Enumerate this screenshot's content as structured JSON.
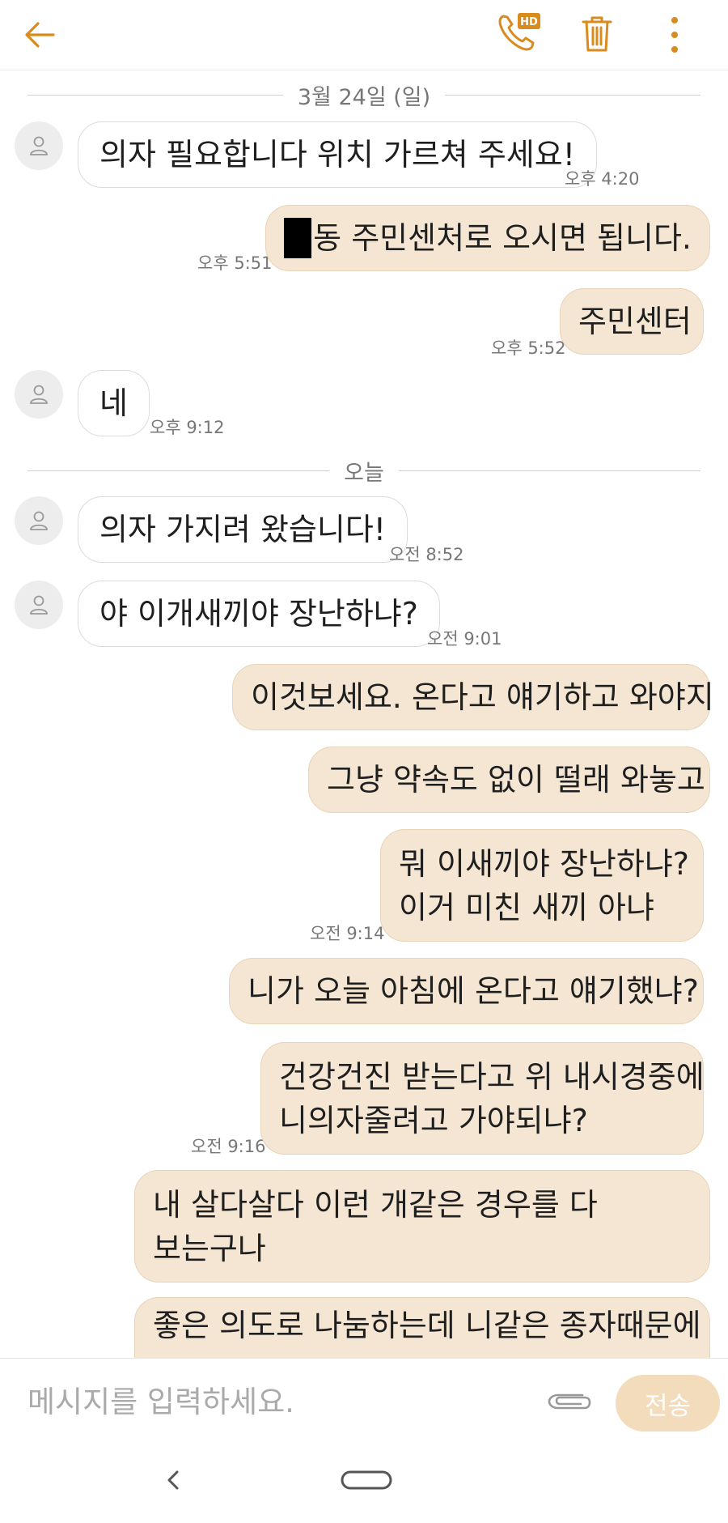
{
  "accent_color": "#d98b1e",
  "icons": {
    "back": "back-arrow-icon",
    "hd_call": "hd-phone-icon",
    "delete": "trash-icon",
    "more": "more-vert-icon",
    "attach": "paperclip-icon",
    "nav_back": "nav-back-icon",
    "nav_home": "nav-home-icon"
  },
  "toolbar": {
    "hd_badge": "HD"
  },
  "dividers": {
    "date1": "3월 24일 (일)",
    "today": "오늘"
  },
  "messages": [
    {
      "dir": "in",
      "text": "의자 필요합니다 위치 가르쳐 주세요!",
      "time": "오후 4:20"
    },
    {
      "dir": "out",
      "text": "동 주민센처로 오시면 됩니다.",
      "time": "오후 5:51",
      "redacted": true
    },
    {
      "dir": "out",
      "text": "주민센터",
      "time": "오후 5:52"
    },
    {
      "dir": "in",
      "text": "네",
      "time": "오후 9:12"
    },
    {
      "dir": "in",
      "text": "의자 가지려 왔습니다!",
      "time": "오전 8:52"
    },
    {
      "dir": "in",
      "text": "야 이개새끼야 장난하냐?",
      "time": "오전 9:01"
    },
    {
      "dir": "out",
      "text": "이것보세요. 온다고 얘기하고 와야지",
      "time": ""
    },
    {
      "dir": "out",
      "text": "그냥 약속도 없이 떨래 와놓고",
      "time": ""
    },
    {
      "dir": "out",
      "lines": [
        "뭐 이새끼야 장난하냐?",
        "이거 미친 새끼 아냐"
      ],
      "time": "오전 9:14"
    },
    {
      "dir": "out",
      "text": "니가 오늘 아침에 온다고 얘기했냐?",
      "time": ""
    },
    {
      "dir": "out",
      "lines": [
        "건강건진 받는다고 위 내시경중에",
        "니의자줄려고 가야되냐?"
      ],
      "time": "오전 9:16"
    },
    {
      "dir": "out",
      "lines": [
        "내 살다살다 이런 개같은 경우를 다",
        "보는구나"
      ],
      "time": ""
    },
    {
      "dir": "out",
      "text": "좋은 의도로 나눔하는데 니같은 종자때문에",
      "time": ""
    }
  ],
  "composer": {
    "placeholder": "메시지를 입력하세요.",
    "send_label": "전송"
  }
}
